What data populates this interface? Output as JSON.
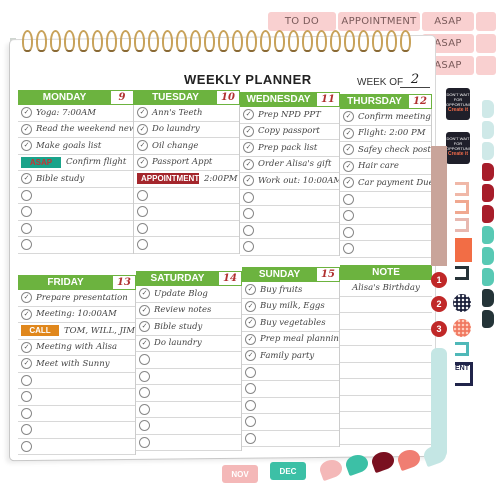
{
  "stickers": {
    "top_tabs": [
      "TO DO",
      "APPOINTMENT",
      "ASAP",
      "ASAP",
      "ASAP"
    ],
    "month_tabs": [
      "NOV",
      "DEC"
    ],
    "number_dots": [
      "1",
      "2",
      "3"
    ],
    "motivational_text": [
      "DON'T WAIT FOR OPPORTUNITY",
      "Create it"
    ],
    "appointment_fragment": "ENT"
  },
  "planner": {
    "title": "WEEKLY PLANNER",
    "week_of_label": "WEEK OF",
    "week_number": "2",
    "accent_color": "#6cb33f",
    "days": [
      {
        "name": "MONDAY",
        "date": "9",
        "items": [
          {
            "type": "check",
            "text": "Yoga: 7:00AM"
          },
          {
            "type": "check",
            "text": "Read the weekend news"
          },
          {
            "type": "check",
            "text": "Make goals list"
          },
          {
            "type": "badge",
            "badge": "ASAP",
            "text": "Confirm flight"
          },
          {
            "type": "check",
            "text": "Bible study"
          },
          {
            "type": "empty"
          },
          {
            "type": "empty"
          },
          {
            "type": "empty"
          },
          {
            "type": "empty"
          }
        ]
      },
      {
        "name": "TUESDAY",
        "date": "10",
        "items": [
          {
            "type": "check",
            "text": "Ann's Teeth"
          },
          {
            "type": "check",
            "text": "Do laundry"
          },
          {
            "type": "check",
            "text": "Oil change"
          },
          {
            "type": "check",
            "text": "Passport Appt"
          },
          {
            "type": "badge",
            "badge": "APPOINTMENT",
            "text": "2:00PM"
          },
          {
            "type": "empty"
          },
          {
            "type": "empty"
          },
          {
            "type": "empty"
          },
          {
            "type": "empty"
          }
        ]
      },
      {
        "name": "WEDNESDAY",
        "date": "11",
        "items": [
          {
            "type": "check",
            "text": "Prep NPD PPT"
          },
          {
            "type": "check",
            "text": "Copy passport"
          },
          {
            "type": "check",
            "text": "Prep pack list"
          },
          {
            "type": "check",
            "text": "Order Alisa's gift"
          },
          {
            "type": "check",
            "text": "Work out: 10:00AM"
          },
          {
            "type": "empty"
          },
          {
            "type": "empty"
          },
          {
            "type": "empty"
          },
          {
            "type": "empty"
          }
        ]
      },
      {
        "name": "THURSDAY",
        "date": "12",
        "items": [
          {
            "type": "check",
            "text": "Confirm meeting detils"
          },
          {
            "type": "check",
            "text": "Flight: 2:00 PM"
          },
          {
            "type": "check",
            "text": "Safey check posters"
          },
          {
            "type": "check",
            "text": "Hair care"
          },
          {
            "type": "check",
            "text": "Car payment Due"
          },
          {
            "type": "empty"
          },
          {
            "type": "empty"
          },
          {
            "type": "empty"
          },
          {
            "type": "empty"
          }
        ]
      },
      {
        "name": "FRIDAY",
        "date": "13",
        "items": [
          {
            "type": "check",
            "text": "Prepare presentation"
          },
          {
            "type": "check",
            "text": "Meeting: 10:00AM"
          },
          {
            "type": "badge",
            "badge": "CALL",
            "text": "TOM, WILL, JIM"
          },
          {
            "type": "check",
            "text": "Meeting with Alisa"
          },
          {
            "type": "check",
            "text": "Meet with Sunny"
          },
          {
            "type": "empty"
          },
          {
            "type": "empty"
          },
          {
            "type": "empty"
          },
          {
            "type": "empty"
          },
          {
            "type": "empty"
          }
        ]
      },
      {
        "name": "SATURDAY",
        "date": "14",
        "items": [
          {
            "type": "check",
            "text": "Update Blog"
          },
          {
            "type": "check",
            "text": "Review notes"
          },
          {
            "type": "check",
            "text": "Bible study"
          },
          {
            "type": "check",
            "text": "Do laundry"
          },
          {
            "type": "empty"
          },
          {
            "type": "empty"
          },
          {
            "type": "empty"
          },
          {
            "type": "empty"
          },
          {
            "type": "empty"
          },
          {
            "type": "empty"
          }
        ]
      },
      {
        "name": "SUNDAY",
        "date": "15",
        "items": [
          {
            "type": "check",
            "text": "Buy fruits"
          },
          {
            "type": "check",
            "text": "Buy milk, Eggs"
          },
          {
            "type": "check",
            "text": "Buy vegetables"
          },
          {
            "type": "check",
            "text": "Prep meal planning"
          },
          {
            "type": "check",
            "text": "Family party"
          },
          {
            "type": "empty"
          },
          {
            "type": "empty"
          },
          {
            "type": "empty"
          },
          {
            "type": "empty"
          },
          {
            "type": "empty"
          }
        ]
      }
    ],
    "note": {
      "title": "NOTE",
      "lines": [
        "Alisa's Birthday",
        "",
        "",
        "",
        "",
        "",
        "",
        "",
        "",
        ""
      ]
    }
  }
}
